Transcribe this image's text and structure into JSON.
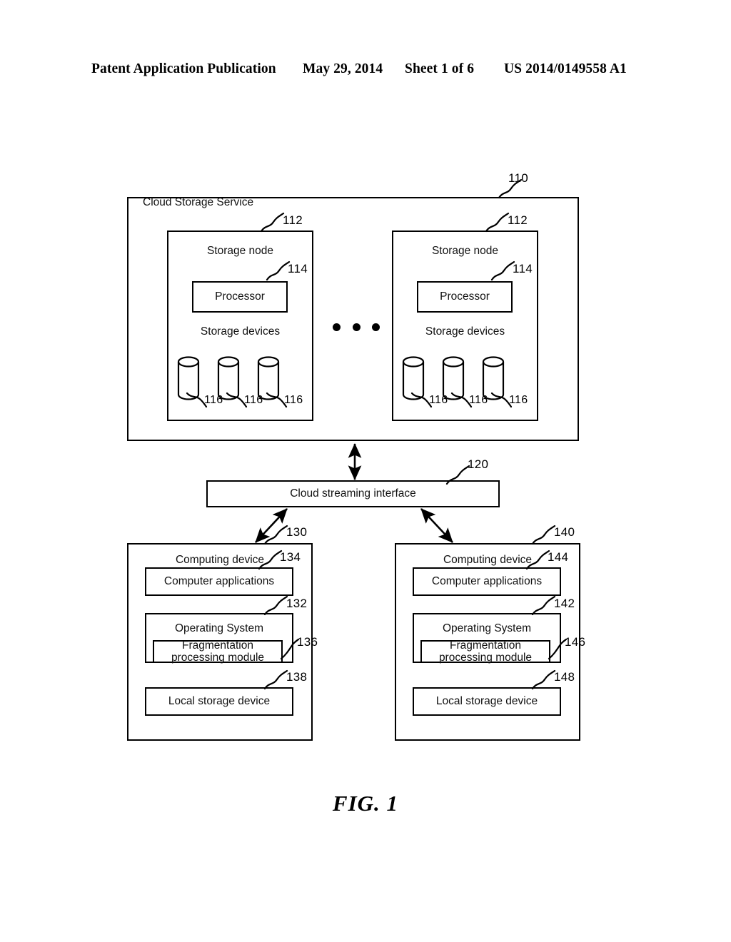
{
  "header": {
    "publication": "Patent Application Publication",
    "date": "May 29, 2014",
    "sheet": "Sheet 1 of 6",
    "patent_number": "US 2014/0149558 A1"
  },
  "figure": {
    "caption": "FIG. 1",
    "cloud_service": {
      "title": "Cloud Storage Service",
      "ref": "110",
      "ellipsis": "• • •",
      "nodes": [
        {
          "title": "Storage node",
          "ref": "112",
          "processor": {
            "label": "Processor",
            "ref": "114"
          },
          "storage_devices_label": "Storage devices",
          "devices": [
            {
              "ref": "116"
            },
            {
              "ref": "116"
            },
            {
              "ref": "116"
            }
          ]
        },
        {
          "title": "Storage node",
          "ref": "112",
          "processor": {
            "label": "Processor",
            "ref": "114"
          },
          "storage_devices_label": "Storage devices",
          "devices": [
            {
              "ref": "116"
            },
            {
              "ref": "116"
            },
            {
              "ref": "116"
            }
          ]
        }
      ]
    },
    "streaming_interface": {
      "label": "Cloud streaming interface",
      "ref": "120"
    },
    "computing_devices": [
      {
        "title": "Computing device",
        "ref": "130",
        "applications": {
          "label": "Computer applications",
          "ref": "134"
        },
        "operating_system": {
          "label": "Operating System",
          "ref": "132"
        },
        "fragmentation_module": {
          "line1": "Fragmentation",
          "line2": "processing module",
          "ref": "136"
        },
        "local_storage": {
          "label": "Local storage device",
          "ref": "138"
        }
      },
      {
        "title": "Computing device",
        "ref": "140",
        "applications": {
          "label": "Computer applications",
          "ref": "144"
        },
        "operating_system": {
          "label": "Operating System",
          "ref": "142"
        },
        "fragmentation_module": {
          "line1": "Fragmentation",
          "line2": "processing module",
          "ref": "146"
        },
        "local_storage": {
          "label": "Local storage device",
          "ref": "148"
        }
      }
    ]
  }
}
